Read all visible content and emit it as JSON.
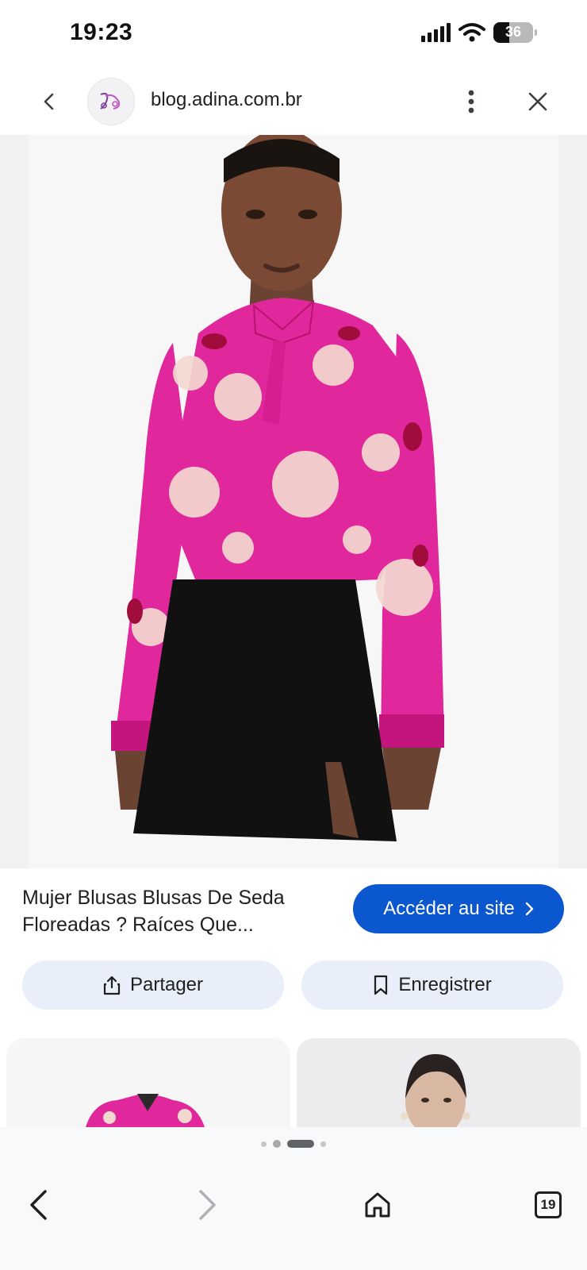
{
  "status_bar": {
    "time": "19:23",
    "battery_level": "36"
  },
  "top_bar": {
    "site_url": "blog.adina.com.br"
  },
  "result": {
    "title": "Mujer Blusas Blusas De Seda Floreadas ? Raíces Que...",
    "visit_label": "Accéder au site",
    "share_label": "Partager",
    "save_label": "Enregistrer"
  },
  "pagination": {
    "active_index": 2,
    "count": 4
  },
  "bottom_nav": {
    "tab_count": "19"
  },
  "colors": {
    "accent": "#0b57d0",
    "action_bg": "#e8effa",
    "blouse": "#e0289c",
    "skirt": "#111111"
  },
  "icons": [
    "back-icon",
    "favicon-icon",
    "more-vert-icon",
    "close-icon",
    "chevron-right-icon",
    "share-icon",
    "bookmark-icon",
    "nav-back-icon",
    "nav-forward-icon",
    "home-icon",
    "tabs-icon",
    "signal-icon",
    "wifi-icon",
    "battery-icon"
  ]
}
